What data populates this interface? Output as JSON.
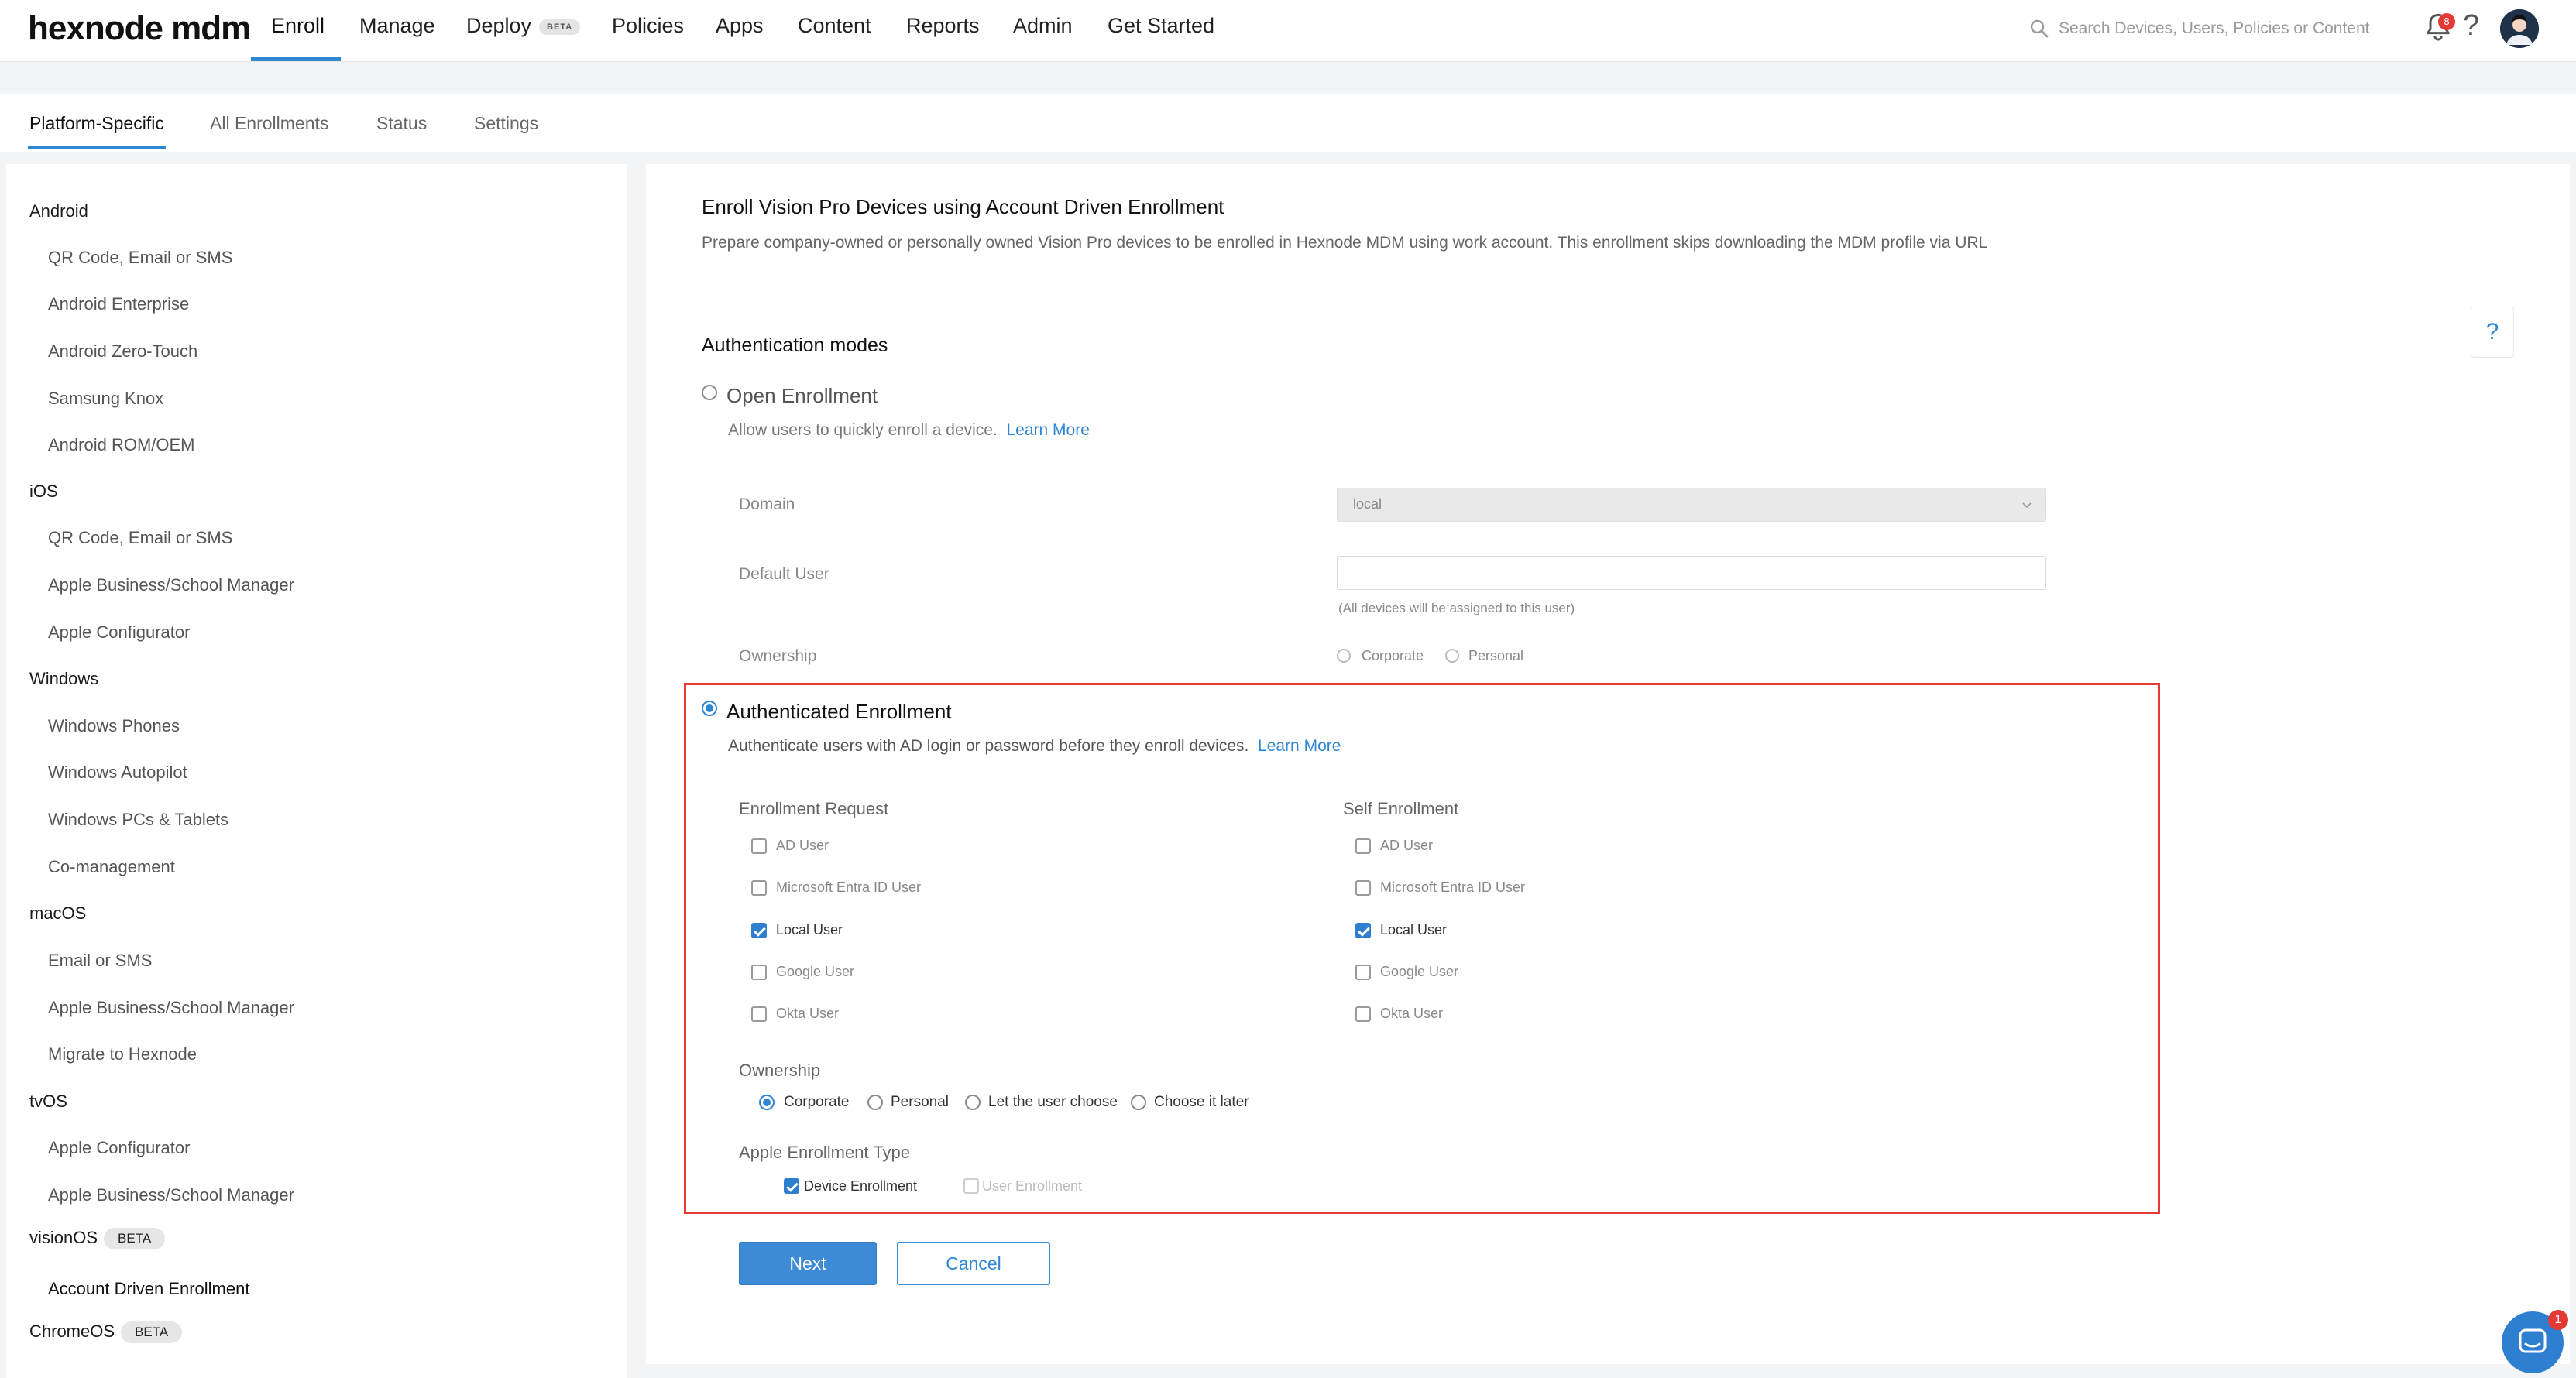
{
  "header": {
    "logo": "hexnode mdm",
    "nav": [
      "Enroll",
      "Manage",
      "Deploy",
      "Policies",
      "Apps",
      "Content",
      "Reports",
      "Admin",
      "Get Started"
    ],
    "deploy_badge": "BETA",
    "search_placeholder": "Search Devices, Users, Policies or Content",
    "notification_count": "8",
    "active_nav": "Enroll",
    "accent_color": "#2f86d3"
  },
  "subtabs": [
    "Platform-Specific",
    "All Enrollments",
    "Status",
    "Settings"
  ],
  "sidebar": {
    "android": {
      "label": "Android",
      "items": [
        "QR Code, Email or SMS",
        "Android Enterprise",
        "Android Zero-Touch",
        "Samsung Knox",
        "Android ROM/OEM"
      ]
    },
    "ios": {
      "label": "iOS",
      "items": [
        "QR Code, Email or SMS",
        "Apple Business/School Manager",
        "Apple Configurator"
      ]
    },
    "windows": {
      "label": "Windows",
      "items": [
        "Windows Phones",
        "Windows Autopilot",
        "Windows PCs & Tablets",
        "Co-management"
      ]
    },
    "macos": {
      "label": "macOS",
      "items": [
        "Email or SMS",
        "Apple Business/School Manager",
        "Migrate to Hexnode"
      ]
    },
    "tvos": {
      "label": "tvOS",
      "items": [
        "Apple Configurator",
        "Apple Business/School Manager"
      ]
    },
    "visionos": {
      "label": "visionOS",
      "badge": "BETA",
      "items": [
        "Account Driven Enrollment"
      ]
    },
    "chromeos": {
      "label": "ChromeOS",
      "badge": "BETA"
    }
  },
  "main": {
    "title": "Enroll Vision Pro Devices using Account Driven Enrollment",
    "description": "Prepare company-owned or personally owned Vision Pro devices to be enrolled in Hexnode MDM using work account. This enrollment skips downloading the MDM profile via URL",
    "auth_modes_heading": "Authentication modes",
    "help_icon": "?",
    "open": {
      "label": "Open Enrollment",
      "description": "Allow users to quickly enroll a device.",
      "learn_more": "Learn More",
      "domain_label": "Domain",
      "domain_value": "local",
      "default_user_label": "Default User",
      "default_user_value": "",
      "default_user_hint": "(All devices will be assigned to this user)",
      "ownership_label": "Ownership",
      "ownership_options": [
        "Corporate",
        "Personal"
      ]
    },
    "authenticated": {
      "label": "Authenticated Enrollment",
      "description": "Authenticate users with AD login or password before they enroll devices.",
      "learn_more": "Learn More",
      "enrollment_request": {
        "heading": "Enrollment Request",
        "options": [
          "AD User",
          "Microsoft Entra ID User",
          "Local User",
          "Google User",
          "Okta User"
        ],
        "checked": [
          false,
          false,
          true,
          false,
          false
        ]
      },
      "self_enrollment": {
        "heading": "Self Enrollment",
        "options": [
          "AD User",
          "Microsoft Entra ID User",
          "Local User",
          "Google User",
          "Okta User"
        ],
        "checked": [
          false,
          false,
          true,
          false,
          false
        ]
      },
      "ownership_label": "Ownership",
      "ownership_options": [
        "Corporate",
        "Personal",
        "Let the user choose",
        "Choose it later"
      ],
      "ownership_selected": "Corporate",
      "enrollment_type_label": "Apple Enrollment Type",
      "device_enrollment": "Device Enrollment",
      "user_enrollment": "User Enrollment"
    },
    "next_label": "Next",
    "cancel_label": "Cancel",
    "highlight_color": "#e53935"
  },
  "chat_badge": "1"
}
